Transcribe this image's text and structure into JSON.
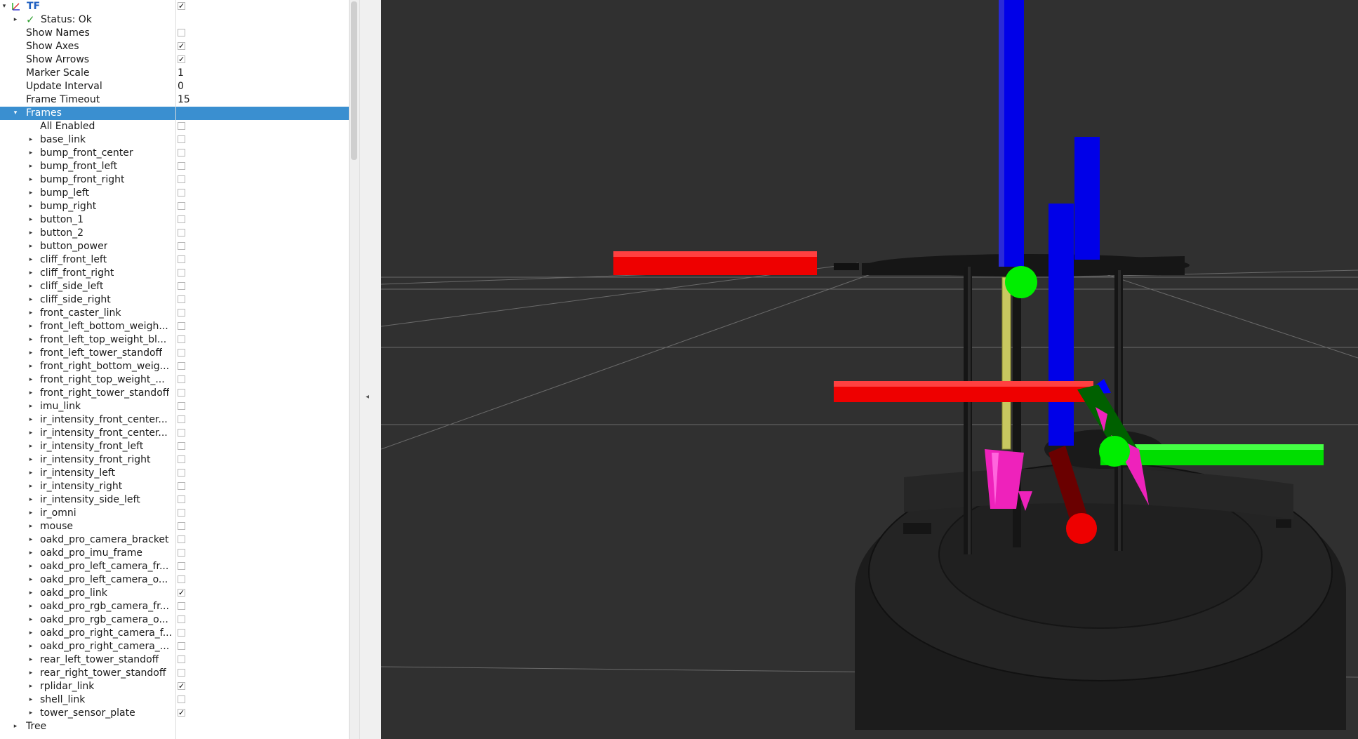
{
  "display": {
    "name": "TF",
    "enabled": true,
    "status": "Status: Ok",
    "properties": [
      {
        "label": "Show Names",
        "kind": "checkbox",
        "checked": false
      },
      {
        "label": "Show Axes",
        "kind": "checkbox",
        "checked": true
      },
      {
        "label": "Show Arrows",
        "kind": "checkbox",
        "checked": true
      },
      {
        "label": "Marker Scale",
        "kind": "value",
        "value": "1"
      },
      {
        "label": "Update Interval",
        "kind": "value",
        "value": "0"
      },
      {
        "label": "Frame Timeout",
        "kind": "value",
        "value": "15"
      }
    ],
    "frames_label": "Frames",
    "all_enabled": {
      "label": "All Enabled",
      "checked": false
    },
    "frames": [
      {
        "name": "base_link",
        "checked": false
      },
      {
        "name": "bump_front_center",
        "checked": false
      },
      {
        "name": "bump_front_left",
        "checked": false
      },
      {
        "name": "bump_front_right",
        "checked": false
      },
      {
        "name": "bump_left",
        "checked": false
      },
      {
        "name": "bump_right",
        "checked": false
      },
      {
        "name": "button_1",
        "checked": false
      },
      {
        "name": "button_2",
        "checked": false
      },
      {
        "name": "button_power",
        "checked": false
      },
      {
        "name": "cliff_front_left",
        "checked": false
      },
      {
        "name": "cliff_front_right",
        "checked": false
      },
      {
        "name": "cliff_side_left",
        "checked": false
      },
      {
        "name": "cliff_side_right",
        "checked": false
      },
      {
        "name": "front_caster_link",
        "checked": false
      },
      {
        "name": "front_left_bottom_weigh...",
        "checked": false
      },
      {
        "name": "front_left_top_weight_bl...",
        "checked": false
      },
      {
        "name": "front_left_tower_standoff",
        "checked": false
      },
      {
        "name": "front_right_bottom_weig...",
        "checked": false
      },
      {
        "name": "front_right_top_weight_...",
        "checked": false
      },
      {
        "name": "front_right_tower_standoff",
        "checked": false
      },
      {
        "name": "imu_link",
        "checked": false
      },
      {
        "name": "ir_intensity_front_center...",
        "checked": false
      },
      {
        "name": "ir_intensity_front_center...",
        "checked": false
      },
      {
        "name": "ir_intensity_front_left",
        "checked": false
      },
      {
        "name": "ir_intensity_front_right",
        "checked": false
      },
      {
        "name": "ir_intensity_left",
        "checked": false
      },
      {
        "name": "ir_intensity_right",
        "checked": false
      },
      {
        "name": "ir_intensity_side_left",
        "checked": false
      },
      {
        "name": "ir_omni",
        "checked": false
      },
      {
        "name": "mouse",
        "checked": false
      },
      {
        "name": "oakd_pro_camera_bracket",
        "checked": false
      },
      {
        "name": "oakd_pro_imu_frame",
        "checked": false
      },
      {
        "name": "oakd_pro_left_camera_fr...",
        "checked": false
      },
      {
        "name": "oakd_pro_left_camera_o...",
        "checked": false
      },
      {
        "name": "oakd_pro_link",
        "checked": true
      },
      {
        "name": "oakd_pro_rgb_camera_fr...",
        "checked": false
      },
      {
        "name": "oakd_pro_rgb_camera_o...",
        "checked": false
      },
      {
        "name": "oakd_pro_right_camera_f...",
        "checked": false
      },
      {
        "name": "oakd_pro_right_camera_...",
        "checked": false
      },
      {
        "name": "rear_left_tower_standoff",
        "checked": false
      },
      {
        "name": "rear_right_tower_standoff",
        "checked": false
      },
      {
        "name": "rplidar_link",
        "checked": true
      },
      {
        "name": "shell_link",
        "checked": false
      },
      {
        "name": "tower_sensor_plate",
        "checked": true
      }
    ],
    "tree_label": "Tree"
  },
  "colors": {
    "selection": "#3a8fd0",
    "viewport_bg": "#303030",
    "status_ok": "#2e9e2e",
    "axis_x": "#ff0000",
    "axis_y": "#00e000",
    "axis_z": "#0000ff",
    "arrow": "#ff33cc"
  }
}
